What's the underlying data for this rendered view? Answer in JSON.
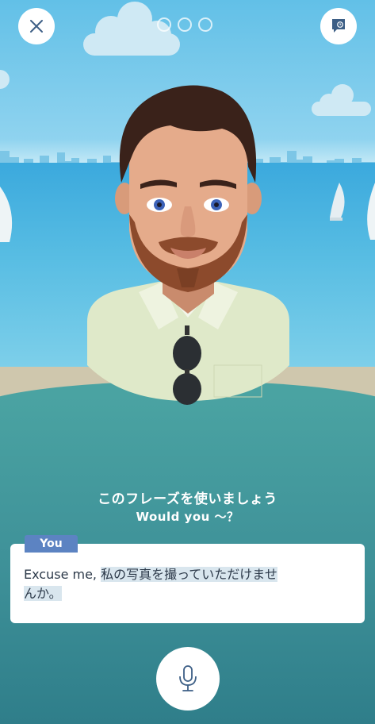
{
  "header": {
    "close_icon": "close-icon",
    "hint_icon": "chat-bubble-icon",
    "progress_total": 3,
    "progress_current": 0
  },
  "prompt": {
    "title": "このフレーズを使いましょう",
    "subtitle": "Would you 〜？"
  },
  "card": {
    "speaker_tag": "You",
    "text_plain": "Excuse me, ",
    "text_highlight_1": "私の写真を撮っていただけませ",
    "text_highlight_2": "んか。"
  },
  "footer": {
    "mic_icon": "microphone-icon"
  },
  "colors": {
    "sky": "#62c0e7",
    "sea": "#3ba9dd",
    "lower_bg": "#3f9299",
    "tag": "#5c83c2",
    "highlight": "#d9e6ee"
  }
}
